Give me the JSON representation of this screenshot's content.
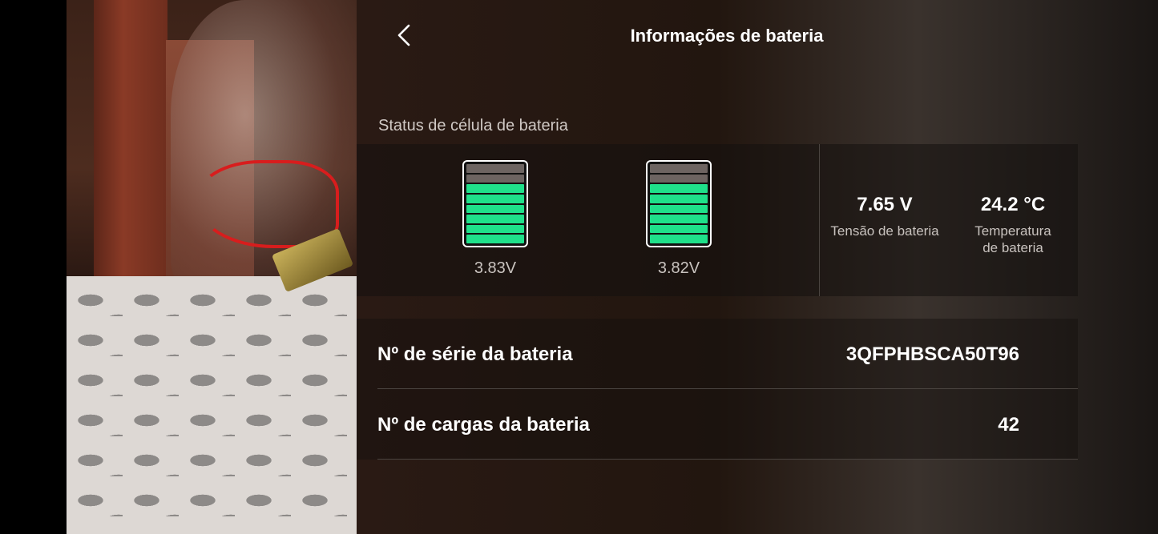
{
  "header": {
    "title": "Informações de bateria",
    "back_icon": "chevron-left-icon"
  },
  "cell_status": {
    "label": "Status de célula de bateria",
    "cells": [
      {
        "voltage": "3.83V",
        "level_segments": 6,
        "total_segments": 8
      },
      {
        "voltage": "3.82V",
        "level_segments": 6,
        "total_segments": 8
      }
    ],
    "fill_color": "#1fe08a",
    "empty_color": "#6d6461"
  },
  "stats": {
    "voltage": {
      "value": "7.65 V",
      "label": "Tensão de bateria"
    },
    "temperature": {
      "value": "24.2 °C",
      "label_line1": "Temperatura",
      "label_line2": "de bateria"
    }
  },
  "info": {
    "serial": {
      "label": "Nº de série da bateria",
      "value": "3QFPHBSCA50T96"
    },
    "charges": {
      "label": "Nº de cargas da bateria",
      "value": "42"
    }
  }
}
